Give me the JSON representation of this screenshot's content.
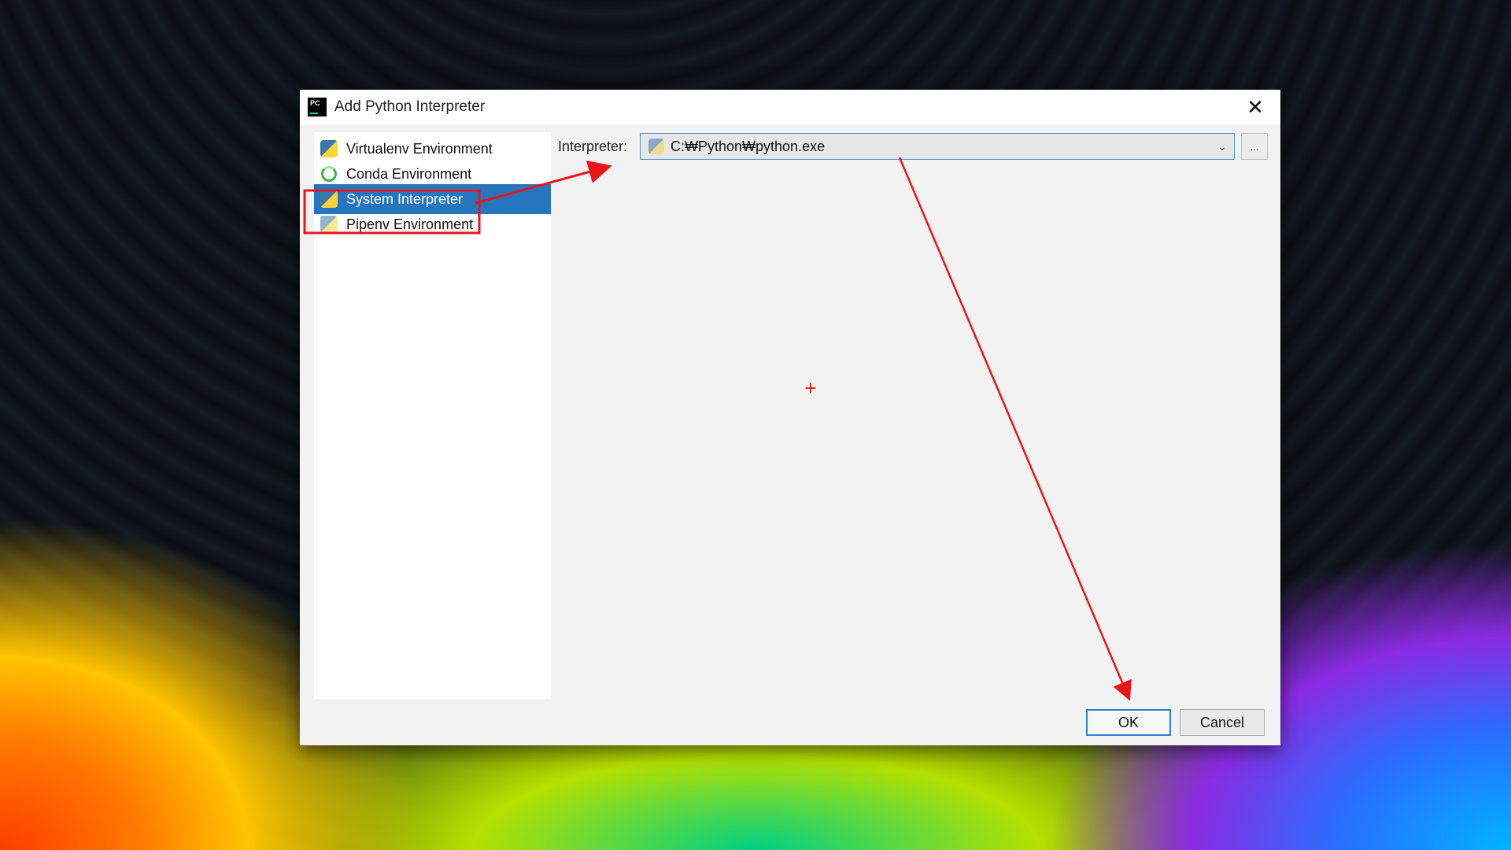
{
  "dialog": {
    "title": "Add Python Interpreter",
    "app_icon_text": "PC",
    "close_glyph": "✕"
  },
  "sidebar": {
    "items": [
      {
        "label": "Virtualenv Environment",
        "icon": "virtualenv-icon",
        "selected": false
      },
      {
        "label": "Conda Environment",
        "icon": "conda-icon",
        "selected": false
      },
      {
        "label": "System Interpreter",
        "icon": "python-icon",
        "selected": true
      },
      {
        "label": "Pipenv Environment",
        "icon": "pipenv-icon",
        "selected": false
      }
    ]
  },
  "interpreter": {
    "label": "Interpreter:",
    "value": "C:₩Python₩python.exe",
    "dropdown_glyph": "⌄",
    "browse_label": "..."
  },
  "buttons": {
    "ok": "OK",
    "cancel": "Cancel"
  },
  "annotations": {
    "color": "#e8161b",
    "arrows": [
      "system-interpreter-to-interpreter-field",
      "interpreter-field-to-ok-button"
    ],
    "cursor_glyph": "+"
  },
  "colors": {
    "selection": "#2675bf",
    "ok_border": "#2f7fd1",
    "dialog_bg": "#f2f2f2"
  }
}
